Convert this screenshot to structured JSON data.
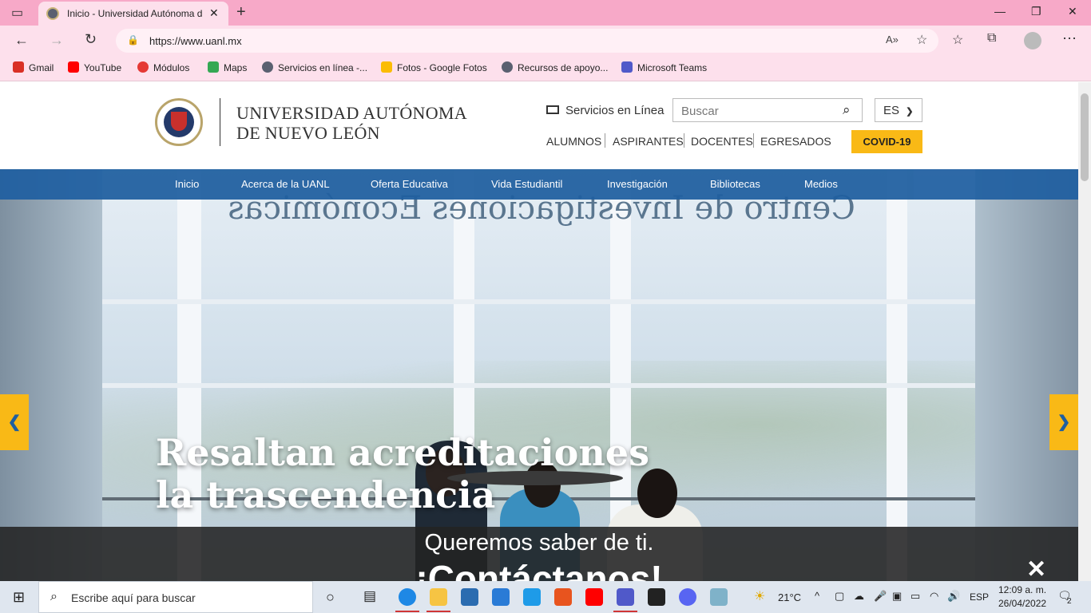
{
  "browser": {
    "tab_title": "Inicio - Universidad Autónoma d",
    "url": "https://www.uanl.mx",
    "bookmarks": [
      {
        "label": "Gmail",
        "color": "#d93025"
      },
      {
        "label": "YouTube",
        "color": "#ff0000"
      },
      {
        "label": "Módulos",
        "color": "#e53935"
      },
      {
        "label": "Maps",
        "color": "#34a853"
      },
      {
        "label": "Servicios en línea -...",
        "color": "#5a6070"
      },
      {
        "label": "Fotos - Google Fotos",
        "color": "#fbbc04"
      },
      {
        "label": "Recursos de apoyo...",
        "color": "#5a6070"
      },
      {
        "label": "Microsoft Teams",
        "color": "#5059c9"
      }
    ]
  },
  "header": {
    "uni_line1": "UNIVERSIDAD AUTÓNOMA",
    "uni_line2": "DE NUEVO LEÓN",
    "servicios": "Servicios en Línea",
    "search_placeholder": "Buscar",
    "lang": "ES",
    "audience": [
      "ALUMNOS",
      "ASPIRANTES",
      "DOCENTES",
      "EGRESADOS"
    ],
    "covid": "COVID-19"
  },
  "nav": [
    "Inicio",
    "Acerca de la UANL",
    "Oferta Educativa",
    "Vida Estudiantil",
    "Investigación",
    "Bibliotecas",
    "Medios"
  ],
  "hero": {
    "wall_sign": "Centro de Investigaciones Económicas",
    "headline": "Resaltan acreditaciones la trascendencia"
  },
  "contact": {
    "line1": "Queremos saber de ti.",
    "line2": "¡Contáctanos!"
  },
  "taskbar": {
    "search_placeholder": "Escribe aquí para buscar",
    "weather": "21°C",
    "lang": "ESP",
    "time": "12:09 a. m.",
    "date": "26/04/2022",
    "notifications": "2"
  },
  "colors": {
    "brand_blue": "#1f5fa0",
    "brand_gold": "#f9b916",
    "chrome_pink": "#f7a9c8"
  }
}
